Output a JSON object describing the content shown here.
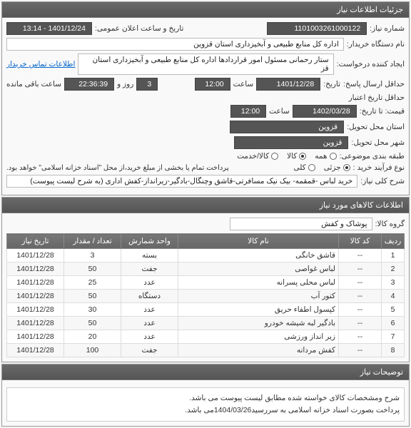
{
  "panel1_title": "جزئیات اطلاعات نیاز",
  "need_number_label": "شماره نیاز:",
  "need_number": "1101003261000122",
  "announce_datetime_label": "تاریخ و ساعت اعلان عمومی:",
  "announce_datetime": "1401/12/24 - 13:14",
  "buyer_device_label": "نام دستگاه خریدار:",
  "buyer_device": "اداره کل منابع طبیعی و آبخیزداری استان قزوین",
  "creator_label": "ایجاد کننده درخواست:",
  "creator": "ستار رحمانی مسئول امور قراردادها اداره کل منابع طبیعی و آبخیزداری استان قز",
  "contact_link": "اطلاعات تماس خریدار",
  "send_deadline_label": "حداقل ارسال پاسخ:",
  "send_deadline_date": "1401/12/28",
  "send_time_label": "ساعت",
  "send_time": "12:00",
  "day_label": "روز و",
  "day_value": "3",
  "remain_label": "ساعت باقی مانده",
  "remain_value": "22:36:39",
  "until_label": "تاریخ:",
  "credit_deadline_label": "حداقل تاریخ اعتبار",
  "credit_deadline_date": "1402/03/28",
  "credit_time_label": "ساعت",
  "credit_time": "12:00",
  "price_until_label": "قیمت: تا تاریخ:",
  "province_label": "استان محل تحویل:",
  "province": "قزوین",
  "city_label": "شهر محل تحویل:",
  "city": "قزوین",
  "subject_class_label": "طبقه بندی موضوعی:",
  "radio_all": "همه",
  "radio_goods": "کالا",
  "radio_service": "کالا/خدمت",
  "buy_type_label": "نوع فرآیند خرید :",
  "radio_partial": "جزئی",
  "radio_total": "کلی",
  "note1": "پرداخت تمام یا بخشی از مبلغ خرید،از محل \"اسناد خزانه اسلامی\" خواهد بود.",
  "desc_label": "شرح کلی نیاز:",
  "desc_text": "خرید لباس -قمقمه- بیک نیک مسافرتی-قاشق وچنگال-بادگیر-زیرانداز-کفش اداری (به شرح لیست پیوست)",
  "panel2_title": "اطلاعات کالاهای مورد نیاز",
  "group_label": "گروه کالا:",
  "group_value": "پوشاک و کفش",
  "table_headers": [
    "ردیف",
    "کد کالا",
    "نام کالا",
    "واحد شمارش",
    "تعداد / مقدار",
    "تاریخ نیاز"
  ],
  "rows": [
    {
      "n": "1",
      "code": "--",
      "name": "قاشق خانگی",
      "unit": "بسته",
      "qty": "3",
      "date": "1401/12/28"
    },
    {
      "n": "2",
      "code": "--",
      "name": "لباس غواصی",
      "unit": "جفت",
      "qty": "50",
      "date": "1401/12/28"
    },
    {
      "n": "3",
      "code": "--",
      "name": "لباس محلی پسرانه",
      "unit": "عدد",
      "qty": "25",
      "date": "1401/12/28"
    },
    {
      "n": "4",
      "code": "--",
      "name": "کتور آب",
      "unit": "دستگاه",
      "qty": "50",
      "date": "1401/12/28"
    },
    {
      "n": "5",
      "code": "--",
      "name": "کپسول اطفاء حریق",
      "unit": "عدد",
      "qty": "30",
      "date": "1401/12/28"
    },
    {
      "n": "6",
      "code": "--",
      "name": "بادگیر لبه شیشه خودرو",
      "unit": "عدد",
      "qty": "50",
      "date": "1401/12/28"
    },
    {
      "n": "7",
      "code": "--",
      "name": "زیر انداز ورزشی",
      "unit": "عدد",
      "qty": "20",
      "date": "1401/12/28"
    },
    {
      "n": "8",
      "code": "--",
      "name": "کفش مردانه",
      "unit": "جفت",
      "qty": "100",
      "date": "1401/12/28"
    }
  ],
  "panel3_title": "توضیحات نیاز",
  "note_line1": "شرح ومشخصات کالای خواسته شده مطابق لیست پیوست می باشد.",
  "note_line2": "پرداخت بصورت اسناد خزانه اسلامی به سررسید1404/03/26می باشد."
}
